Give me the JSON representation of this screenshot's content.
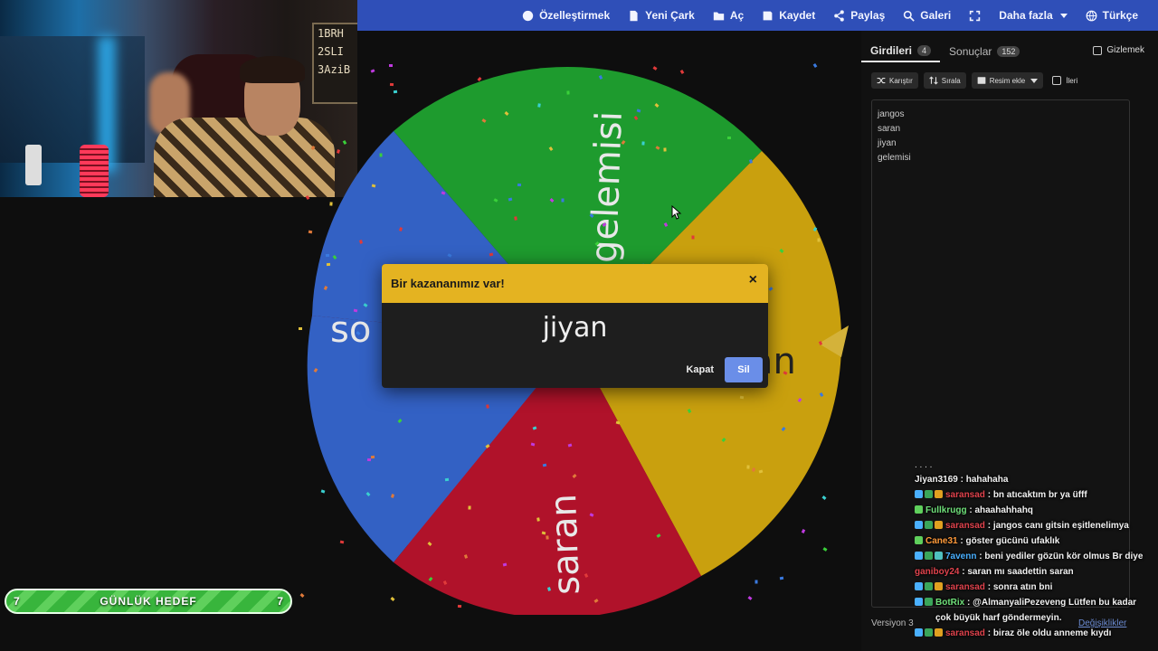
{
  "nav": {
    "customize": "Özelleştirmek",
    "new_wheel": "Yeni Çark",
    "open": "Aç",
    "save": "Kaydet",
    "share": "Paylaş",
    "gallery": "Galeri",
    "more": "Daha fazla",
    "language": "Türkçe"
  },
  "panel": {
    "tab_entries": "Girdileri",
    "tab_entries_count": "4",
    "tab_results": "Sonuçlar",
    "tab_results_count": "152",
    "hide": "Gizlemek",
    "shuffle": "Karıştır",
    "sort": "Sırala",
    "add_image": "Resim ekle",
    "advanced": "İleri",
    "entries": [
      "jangos",
      "saran",
      "jiyan",
      "gelemisi"
    ],
    "version": "Versiyon 3",
    "changes": "Değişiklikler"
  },
  "wheel": {
    "segments": [
      {
        "label": "gelemisi",
        "color": "#1e9b2e"
      },
      {
        "label": "jiyan",
        "color": "#c9a00e"
      },
      {
        "label": "saran",
        "color": "#b0122a"
      },
      {
        "label": "jangos",
        "color": "#3361c4"
      }
    ],
    "visible_labels": {
      "top": "gelemisi",
      "bottom": "saran",
      "left_fragment": "so",
      "right_fragment": "an"
    }
  },
  "modal": {
    "title": "Bir kazananımız var!",
    "close_symbol": "×",
    "winner": "jiyan",
    "close_button": "Kapat",
    "delete_button": "Sil",
    "header_color": "#e4b321"
  },
  "chat": [
    {
      "user": "Jiyan3169",
      "color": "#f2f2f2",
      "badges": [],
      "text": "hahahaha"
    },
    {
      "user": "saransad",
      "color": "#e0434d",
      "badges": [
        "#4ab0ff",
        "#3aa55a",
        "#e0a020"
      ],
      "text": "bn atıcaktım br ya üfff"
    },
    {
      "user": "Fullkrugg",
      "color": "#6fe07a",
      "badges": [
        "#5fd05c"
      ],
      "text": "ahaahahhahq"
    },
    {
      "user": "saransad",
      "color": "#e0434d",
      "badges": [
        "#4ab0ff",
        "#3aa55a",
        "#e0a020"
      ],
      "text": "jangos canı gitsin eşitlenelimya"
    },
    {
      "user": "Cane31",
      "color": "#ff9a3a",
      "badges": [
        "#5fd05c"
      ],
      "text": "göster gücünü ufaklık"
    },
    {
      "user": "7avenn",
      "color": "#4ab0ff",
      "badges": [
        "#4ab0ff",
        "#3aa55a",
        "#4fc0c0"
      ],
      "text": "beni yediler gözün kör olmus Br diye"
    },
    {
      "user": "ganiboy24",
      "color": "#e0434d",
      "badges": [],
      "text": "saran mı saadettin saran"
    },
    {
      "user": "saransad",
      "color": "#e0434d",
      "badges": [
        "#4ab0ff",
        "#3aa55a",
        "#e0a020"
      ],
      "text": "sonra atın bni"
    },
    {
      "user": "BotRix",
      "color": "#6fe07a",
      "badges": [
        "#4ab0ff",
        "#3aa55a"
      ],
      "text": "@AlmanyaliPezeveng Lütfen bu kadar çok büyük harf göndermeyin."
    },
    {
      "user": "saransad",
      "color": "#e0434d",
      "badges": [
        "#4ab0ff",
        "#3aa55a",
        "#e0a020"
      ],
      "text": "biraz öle oldu anneme kıydı"
    }
  ],
  "goal": {
    "left_count": "7",
    "label": "GÜNLÜK HEDEF",
    "right_count": "7"
  },
  "webcam": {
    "board_lines": [
      "1BRH",
      "2SLI",
      "3AziB"
    ]
  }
}
